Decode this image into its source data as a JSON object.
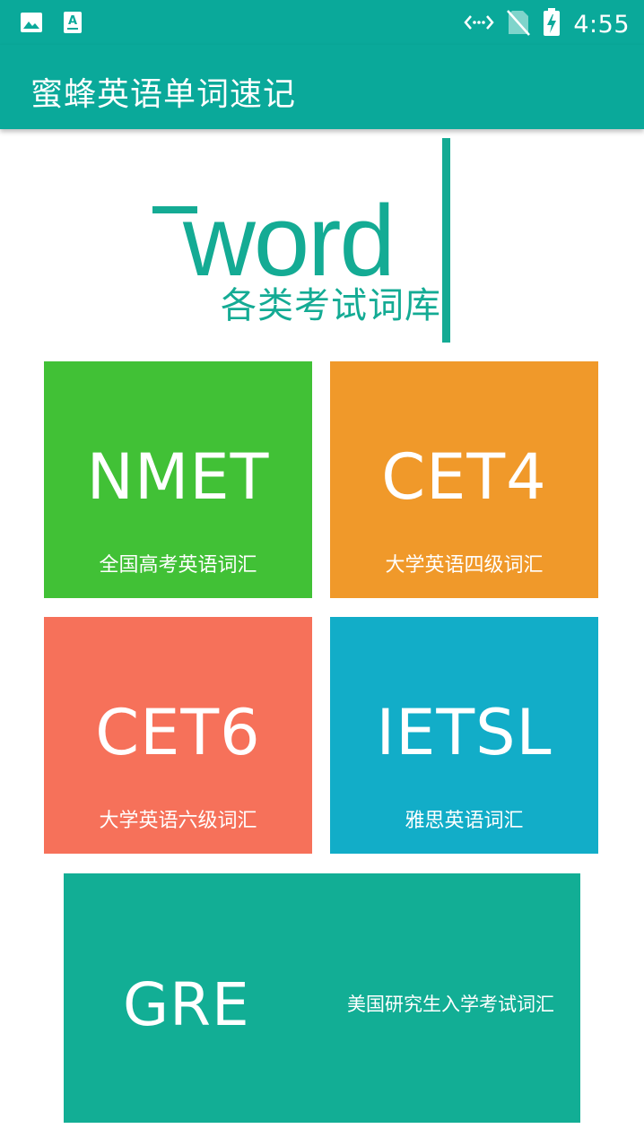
{
  "status_bar": {
    "time": "4:55",
    "left_icons": [
      "image-icon",
      "keyboard-a-icon"
    ],
    "right_icons": [
      "data-arrows-icon",
      "no-sim-icon",
      "battery-charging-icon"
    ]
  },
  "app_bar": {
    "title": "蜜蜂英语单词速记"
  },
  "logo": {
    "word": "word",
    "subtitle": "各类考试词库"
  },
  "colors": {
    "primary": "#0aa99a",
    "nmet": "#41c136",
    "cet4": "#f0992a",
    "cet6": "#f6715a",
    "ietsl": "#12adc8",
    "gre": "#12ae95"
  },
  "tiles": [
    {
      "code": "NMET",
      "desc": "全国高考英语词汇"
    },
    {
      "code": "CET4",
      "desc": "大学英语四级词汇"
    },
    {
      "code": "CET6",
      "desc": "大学英语六级词汇"
    },
    {
      "code": "IETSL",
      "desc": "雅思英语词汇"
    },
    {
      "code": "GRE",
      "desc": "美国研究生入学考试词汇"
    }
  ]
}
